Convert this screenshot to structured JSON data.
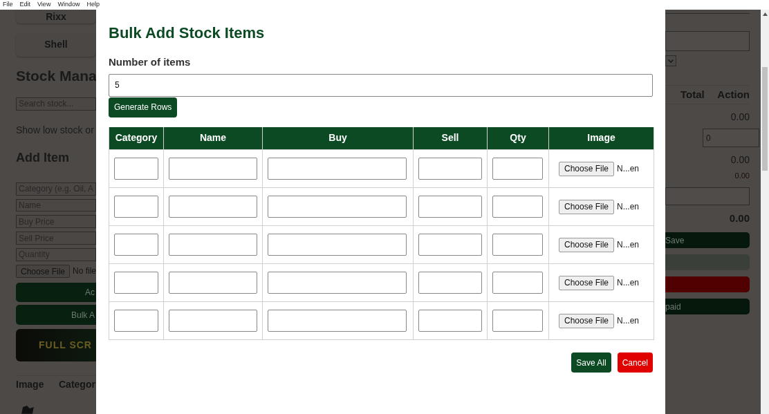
{
  "menu": [
    "File",
    "Edit",
    "View",
    "Window",
    "Help"
  ],
  "left_panel": {
    "store_buttons": [
      "Rixx",
      "Shell"
    ],
    "heading": "Stock Mana",
    "search_placeholder": "Search stock...",
    "low_stock_label": "Show low stock or",
    "add_heading": "Add Item",
    "placeholders": [
      "Category (e.g. Oil, A",
      "Name",
      "Buy Price",
      "Sell Price",
      "Quantity"
    ],
    "file_button": "Choose File",
    "file_status": "No file",
    "buttons": [
      "Ac",
      "Bulk A"
    ],
    "banner": "FULL SCR",
    "table_columns": [
      "Image",
      "Categor"
    ]
  },
  "right_panel": {
    "table_columns": [
      "Total",
      "Action"
    ],
    "items": [
      {
        "kind": "amount",
        "text": "0.00"
      },
      {
        "kind": "input",
        "value": "0"
      },
      {
        "kind": "amount",
        "text": "0.00"
      },
      {
        "kind": "small",
        "text": "0.00"
      },
      {
        "kind": "field"
      },
      {
        "kind": "grand",
        "text": "0.00"
      },
      {
        "kind": "button",
        "color": "#06170b",
        "text": "Save"
      },
      {
        "kind": "button",
        "color": "#3b3f39"
      },
      {
        "kind": "button",
        "color": "#500000"
      },
      {
        "kind": "button",
        "color": "#06170b",
        "text": "paid"
      }
    ]
  },
  "modal": {
    "title": "Bulk Add Stock Items",
    "count_label": "Number of items",
    "count_value": "5",
    "generate_button": "Generate Rows",
    "columns": [
      "Category",
      "Name",
      "Buy",
      "Sell",
      "Qty",
      "Image"
    ],
    "rows": [
      {
        "file_button": "Choose File",
        "file_status": "N...en"
      },
      {
        "file_button": "Choose File",
        "file_status": "N...en"
      },
      {
        "file_button": "Choose File",
        "file_status": "N...en"
      },
      {
        "file_button": "Choose File",
        "file_status": "N...en"
      },
      {
        "file_button": "Choose File",
        "file_status": "N...en"
      }
    ],
    "buttons": [
      {
        "label": "Save All",
        "kind": "primary"
      },
      {
        "label": "Cancel",
        "kind": "danger"
      }
    ]
  }
}
